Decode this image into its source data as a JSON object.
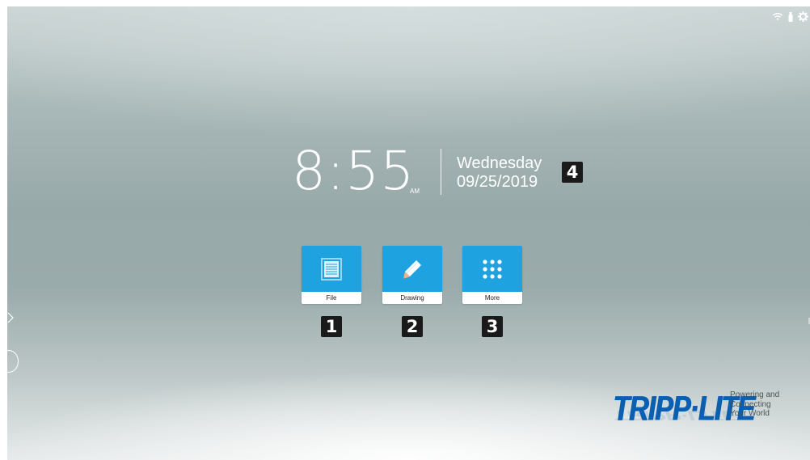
{
  "clock": {
    "time": "8:55",
    "ampm": "AM",
    "day": "Wednesday",
    "date": "09/25/2019"
  },
  "apps": [
    {
      "label": "File",
      "icon": "document-icon"
    },
    {
      "label": "Drawing",
      "icon": "pencil-icon"
    },
    {
      "label": "More",
      "icon": "grid-dots-icon"
    }
  ],
  "callouts": [
    "1",
    "2",
    "3",
    "4"
  ],
  "status_icons": [
    "wifi-icon",
    "usb-icon",
    "settings-gear-icon"
  ],
  "side_controls": [
    "chevron-right-icon",
    "circle-button"
  ],
  "logo": {
    "wordmark": "TRIPP·LITE",
    "tagline": [
      "Powering and",
      "Connecting",
      "Your World"
    ]
  },
  "colors": {
    "tile": "#1fa3e0",
    "callout": "#1a1a1a",
    "logo": "#0a5fb0"
  }
}
